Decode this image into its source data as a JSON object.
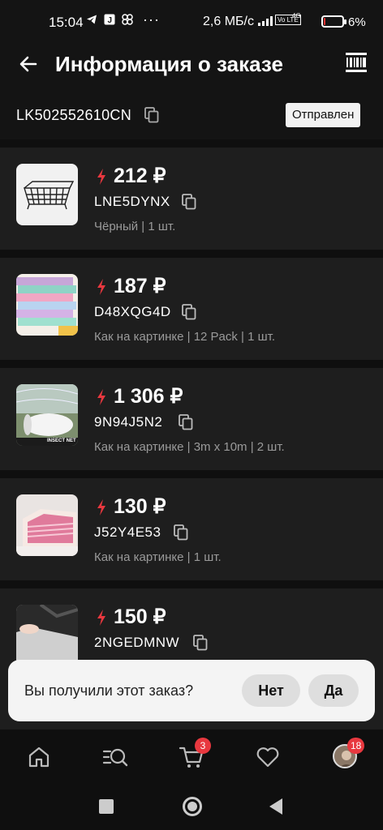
{
  "status_bar": {
    "time": "15:04",
    "left_icons": [
      "telegram-icon",
      "app-j-icon",
      "pinwheel-icon"
    ],
    "more": "···",
    "speed": "2,6 МБ/с",
    "volte": "Vo LTE",
    "network": "4G",
    "battery_percent": "6%",
    "battery_level": 0.06
  },
  "header": {
    "title": "Информация о заказе",
    "back_icon": "arrow-left-icon",
    "barcode_icon": "barcode-icon"
  },
  "order": {
    "tracking_number": "LK502552610CN",
    "status": "Отправлен"
  },
  "items": [
    {
      "price": "212 ₽",
      "code": "LNE5DYNX",
      "desc": "Чёрный | 1 шт.",
      "image": "wire-basket"
    },
    {
      "price": "187 ₽",
      "code": "D48XQG4D",
      "desc": "Как на картинке | 12 Pack | 1 шт.",
      "image": "dish-cloths"
    },
    {
      "price": "1 306 ₽",
      "code": "9N94J5N2",
      "desc": "Как на картинке | 3m x 10m | 2 шт.",
      "image": "insect-net",
      "image_caption": "INSECT NET"
    },
    {
      "price": "130 ₽",
      "code": "J52Y4E53",
      "desc": "Как на картинке | 1 шт.",
      "image": "pink-packets"
    },
    {
      "price": "150 ₽",
      "code": "2NGEDMNW",
      "desc": "",
      "image": "stove-liner"
    }
  ],
  "dialog": {
    "question": "Вы получили этот заказ?",
    "no_label": "Нет",
    "yes_label": "Да"
  },
  "bottom_nav": {
    "cart_badge": "3",
    "profile_badge": "18"
  },
  "colors": {
    "accent": "#e8383f",
    "item_bg": "#1e1e1e",
    "page_bg": "#0f0f0f"
  }
}
